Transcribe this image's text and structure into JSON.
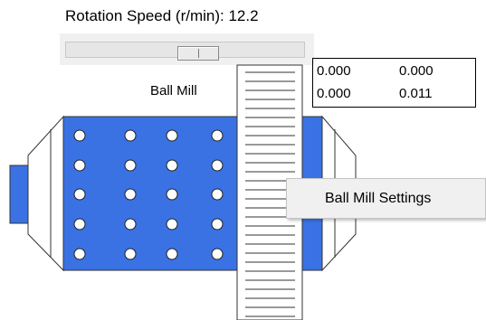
{
  "controls": {
    "speed_label": "Rotation Speed (r/min): 12.2",
    "slider": {
      "value_fraction": 0.55
    }
  },
  "diagram": {
    "label": "Ball Mill",
    "drum_color": "#3a72e4",
    "ball_color": "#ffffff",
    "ball_rows": 5,
    "ball_cols": 4,
    "belt_rungs": 28
  },
  "readout": {
    "rows": [
      [
        "0.000",
        "0.000"
      ],
      [
        "0.000",
        "0.011"
      ]
    ]
  },
  "context_menu": {
    "items": [
      "Ball Mill Settings"
    ]
  }
}
